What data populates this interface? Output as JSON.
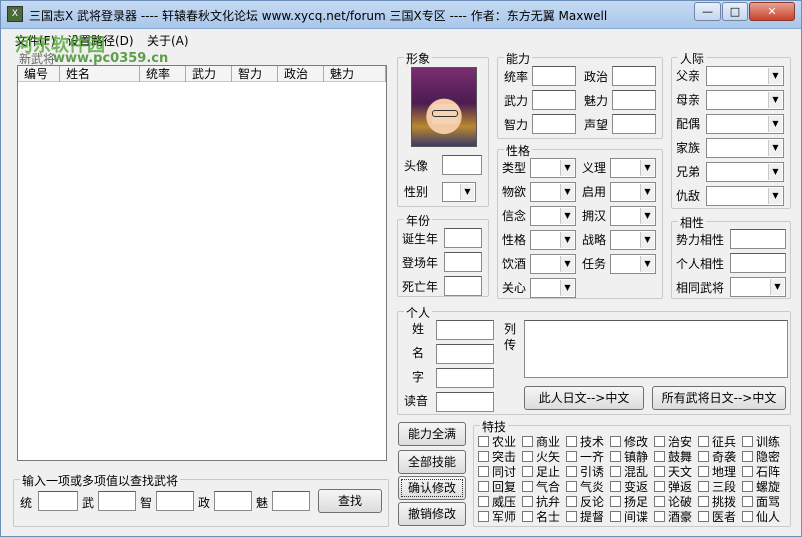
{
  "window": {
    "title": "三国志X 武将登录器 ---- 轩辕春秋文化论坛 www.xycq.net/forum 三国X专区 ---- 作者：东方无翼 Maxwell",
    "icon": "app-icon",
    "controls": {
      "minimize": "—",
      "maximize": "□",
      "close": "✕"
    }
  },
  "menu": {
    "items": [
      "文件(F)",
      "设置路径(D)",
      "关于(A)"
    ]
  },
  "watermark": {
    "site": "河东软件园",
    "url": "www.pc0359.cn"
  },
  "new_general": "新武将",
  "list": {
    "columns": [
      "编号",
      "姓名",
      "统率",
      "武力",
      "智力",
      "政治",
      "魅力"
    ]
  },
  "search": {
    "title": "输入一项或多项值以查找武将",
    "fields": [
      "统",
      "武",
      "智",
      "政",
      "魅"
    ],
    "button": "查找"
  },
  "image_group": {
    "title": "形象",
    "head_label": "头像",
    "gender_label": "性别"
  },
  "ability": {
    "title": "能力",
    "left": [
      "统率",
      "武力",
      "智力"
    ],
    "right": [
      "政治",
      "魅力",
      "声望"
    ]
  },
  "years": {
    "title": "年份",
    "labels": [
      "诞生年",
      "登场年",
      "死亡年"
    ]
  },
  "personality": {
    "title": "性格",
    "left": [
      "类型",
      "物欲",
      "信念",
      "性格",
      "饮酒",
      "关心"
    ],
    "right": [
      "义理",
      "启用",
      "拥汉",
      "战略",
      "任务"
    ]
  },
  "relations": {
    "title": "人际",
    "labels": [
      "父亲",
      "母亲",
      "配偶",
      "家族",
      "兄弟",
      "仇敌"
    ]
  },
  "compat": {
    "title": "相性",
    "labels": [
      "势力相性",
      "个人相性",
      "相同武将"
    ]
  },
  "personal": {
    "title": "个人",
    "labels": [
      "姓",
      "名",
      "字",
      "读音"
    ],
    "bio_label_1": "列",
    "bio_label_2": "传",
    "btn_this": "此人日文-->中文",
    "btn_all": "所有武将日文-->中文"
  },
  "actions": [
    "能力全满",
    "全部技能",
    "确认修改",
    "撤销修改"
  ],
  "skills": {
    "title": "特技",
    "rows": [
      [
        "农业",
        "商业",
        "技术",
        "修改",
        "治安",
        "征兵",
        "训练"
      ],
      [
        "突击",
        "火矢",
        "一齐",
        "镇静",
        "鼓舞",
        "奇袭",
        "隐密"
      ],
      [
        "同讨",
        "足止",
        "引诱",
        "混乱",
        "天文",
        "地理",
        "石阵"
      ],
      [
        "回复",
        "气合",
        "气炎",
        "变返",
        "弹返",
        "三段",
        "螺旋"
      ],
      [
        "威压",
        "抗弁",
        "反论",
        "扬足",
        "论破",
        "挑拨",
        "面骂"
      ],
      [
        "军师",
        "名士",
        "提督",
        "间谍",
        "酒豪",
        "医者",
        "仙人"
      ]
    ]
  }
}
